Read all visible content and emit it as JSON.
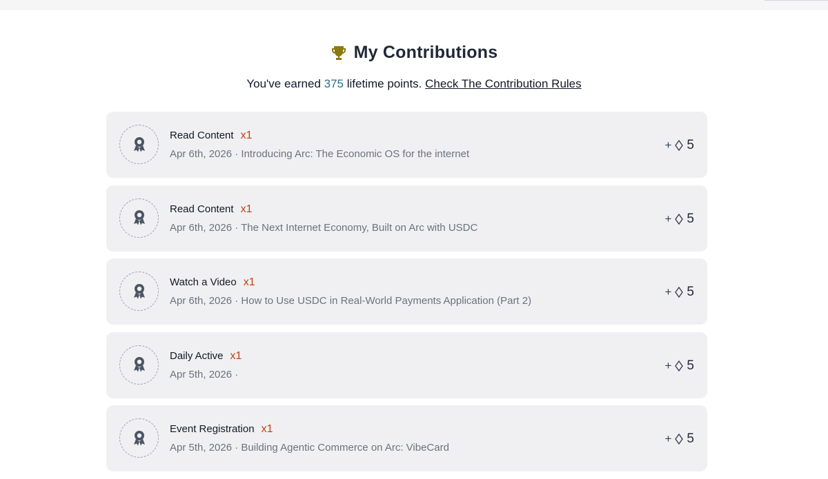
{
  "header": {
    "title": "My Contributions",
    "trophy_icon": "trophy-icon",
    "subtitle_prefix": "You've earned",
    "points": "375",
    "subtitle_suffix": "lifetime points.",
    "rules_link": "Check The Contribution Rules"
  },
  "colors": {
    "card_bg": "#f0f0f2",
    "multiplier": "#c2410c",
    "points_accent": "#2a6f86",
    "trophy": "#8a7a10"
  },
  "contributions": [
    {
      "title": "Read Content",
      "multiplier": "x1",
      "meta": "Apr 6th, 2026 · Introducing Arc: The Economic OS for the internet",
      "plus": "+",
      "value": "5",
      "icon": "award-icon"
    },
    {
      "title": "Read Content",
      "multiplier": "x1",
      "meta": "Apr 6th, 2026 · The Next Internet Economy, Built on Arc with USDC",
      "plus": "+",
      "value": "5",
      "icon": "award-icon"
    },
    {
      "title": "Watch a Video",
      "multiplier": "x1",
      "meta": "Apr 6th, 2026 · How to Use USDC in Real-World Payments Application (Part 2)",
      "plus": "+",
      "value": "5",
      "icon": "award-icon"
    },
    {
      "title": "Daily Active",
      "multiplier": "x1",
      "meta": "Apr 5th, 2026 ·",
      "plus": "+",
      "value": "5",
      "icon": "award-icon"
    },
    {
      "title": "Event Registration",
      "multiplier": "x1",
      "meta": "Apr 5th, 2026 · Building Agentic Commerce on Arc: VibeCard",
      "plus": "+",
      "value": "5",
      "icon": "award-icon"
    }
  ]
}
